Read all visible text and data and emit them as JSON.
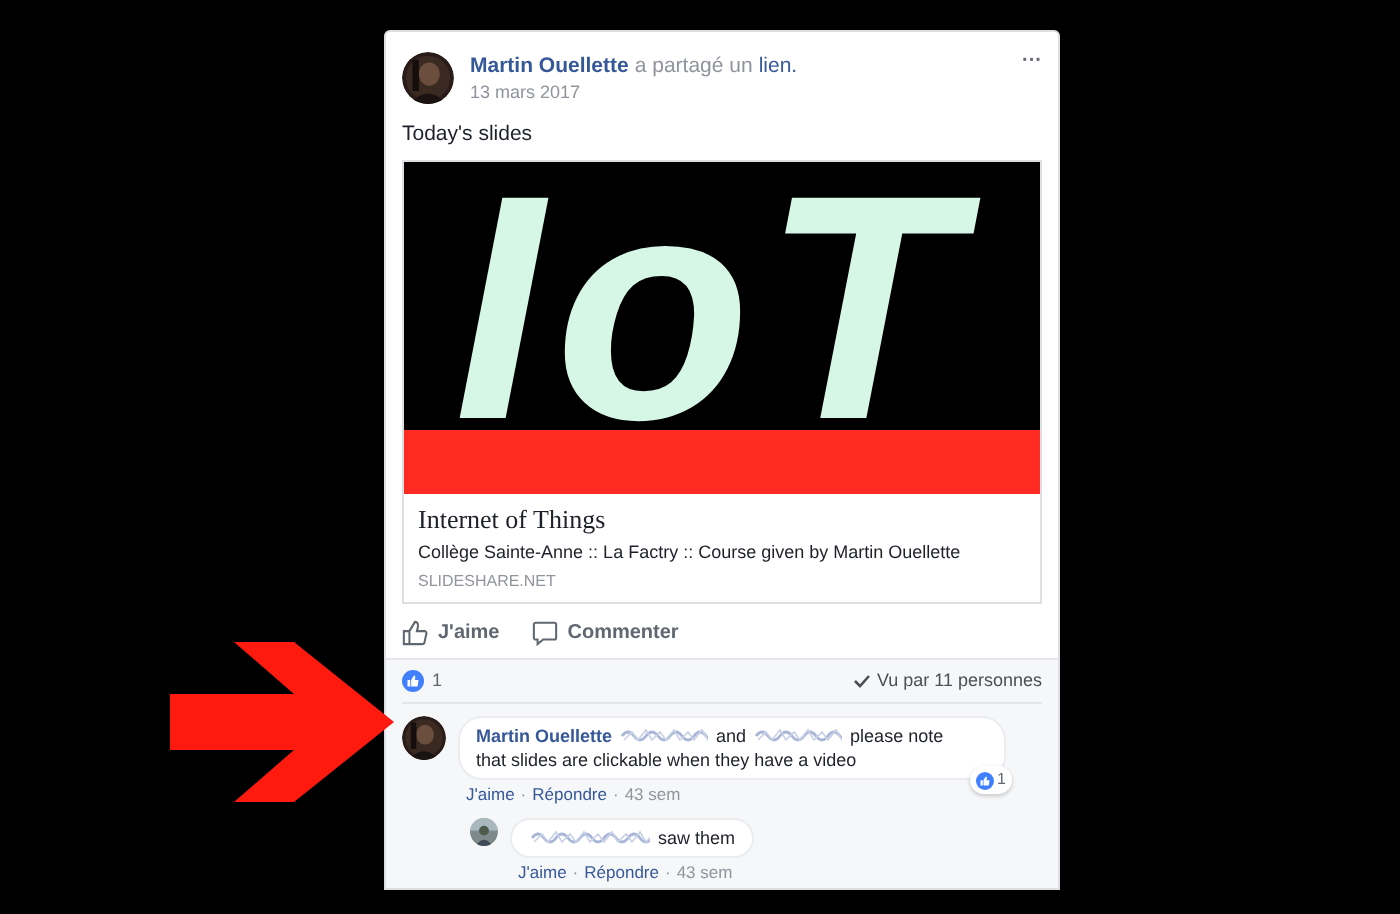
{
  "post": {
    "author": "Martin Ouellette",
    "action": "a partagé un",
    "action_link": "lien.",
    "date": "13 mars 2017",
    "menu": "···",
    "text": "Today's slides",
    "link_preview": {
      "slide_text": "IoT",
      "title": "Internet of Things",
      "description": "Collège Sainte-Anne :: La Factry :: Course given by Martin Ouellette",
      "domain": "SLIDESHARE.NET"
    },
    "actions": [
      {
        "kind": "like",
        "label": "J'aime"
      },
      {
        "kind": "comment",
        "label": "Commenter"
      }
    ],
    "reactions_count": "1",
    "seen_by": "Vu par 11 personnes",
    "comments": [
      {
        "author": "Martin Ouellette",
        "parts": [
          {
            "kind": "redacted"
          },
          {
            "kind": "text",
            "text": "and"
          },
          {
            "kind": "redacted"
          },
          {
            "kind": "text",
            "text": "please note"
          },
          {
            "kind": "text",
            "text": "that slides are clickable when they have a video"
          }
        ],
        "likes": "1",
        "like": "J'aime",
        "separator": "·",
        "reply": "Répondre",
        "time": "43 sem",
        "nested": false
      },
      {
        "parts": [
          {
            "kind": "redacted"
          },
          {
            "kind": "text",
            "text": "saw them"
          }
        ],
        "like": "J'aime",
        "separator": "·",
        "reply": "Répondre",
        "time": "43 sem",
        "nested": true
      }
    ]
  }
}
